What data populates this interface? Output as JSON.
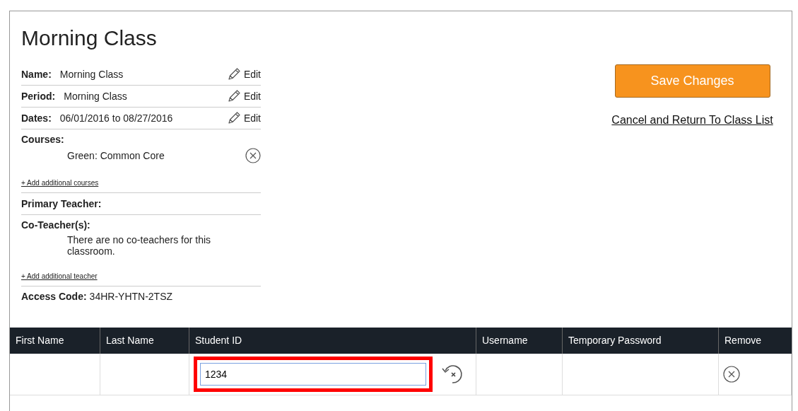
{
  "title": "Morning Class",
  "details": [
    {
      "label": "Name:",
      "value": "Morning Class",
      "action": "Edit"
    },
    {
      "label": "Period:",
      "value": "Morning Class",
      "action": "Edit"
    },
    {
      "label": "Dates:",
      "value": "06/01/2016 to 08/27/2016",
      "action": "Edit"
    }
  ],
  "courses": {
    "label": "Courses:",
    "items": [
      "Green: Common Core"
    ],
    "add_link": "+ Add additional courses"
  },
  "primary_teacher": {
    "label": "Primary Teacher:"
  },
  "co_teachers": {
    "label": "Co-Teacher(s):",
    "empty_text": "There are no co-teachers for this classroom.",
    "add_link": "+ Add additional teacher"
  },
  "access_code": {
    "label": "Access Code:",
    "value": "34HR-YHTN-2TSZ"
  },
  "actions": {
    "save": "Save Changes",
    "cancel": "Cancel and Return To Class List"
  },
  "table": {
    "columns": [
      "First Name",
      "Last Name",
      "Student ID",
      "Username",
      "Temporary Password",
      "Remove"
    ],
    "rows": [
      {
        "student_id": "1234",
        "highlighted": true
      }
    ]
  }
}
